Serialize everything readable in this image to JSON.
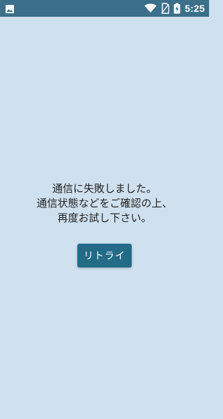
{
  "status_bar": {
    "time": "5:25",
    "icons": [
      "image-icon",
      "wifi-icon",
      "no-sim-icon",
      "battery-charging-icon"
    ]
  },
  "error": {
    "line1": "通信に失敗しました。",
    "line2": "通信状態などをご確認の上、",
    "line3": "再度お試し下さい。"
  },
  "retry_button": {
    "label": "リトライ"
  },
  "colors": {
    "background": "#cfe0ee",
    "status_bar": "#3b6f8a",
    "button": "#236b87",
    "text": "#222222"
  }
}
